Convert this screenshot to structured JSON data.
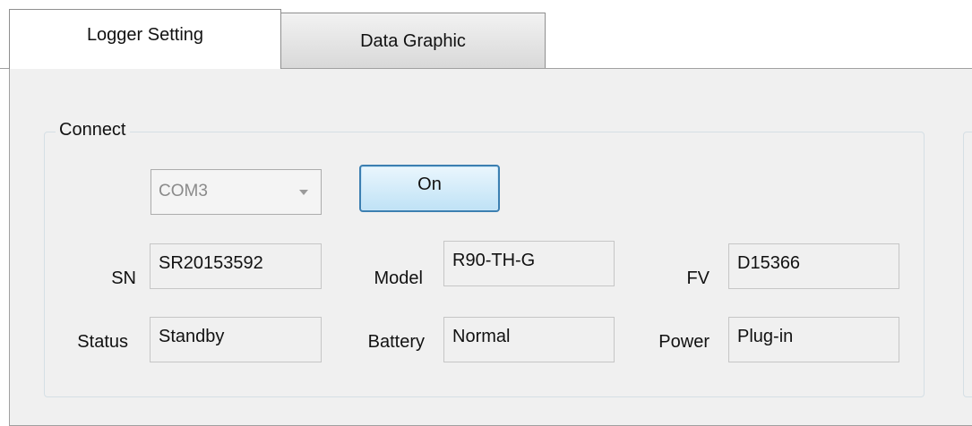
{
  "tabs": [
    {
      "label": "Logger Setting",
      "active": true
    },
    {
      "label": "Data Graphic",
      "active": false
    }
  ],
  "connect": {
    "group_title": "Connect",
    "port_value": "COM3",
    "on_button_label": "On"
  },
  "fields": {
    "sn": {
      "label": "SN",
      "value": "SR20153592"
    },
    "model": {
      "label": "Model",
      "value": "R90-TH-G"
    },
    "fv": {
      "label": "FV",
      "value": "D15366"
    },
    "status": {
      "label": "Status",
      "value": "Standby"
    },
    "battery": {
      "label": "Battery",
      "value": "Normal"
    },
    "power": {
      "label": "Power",
      "value": "Plug-in"
    }
  },
  "colors": {
    "button_border": "#3c7fb1",
    "panel_bg": "#f0f0f0"
  }
}
